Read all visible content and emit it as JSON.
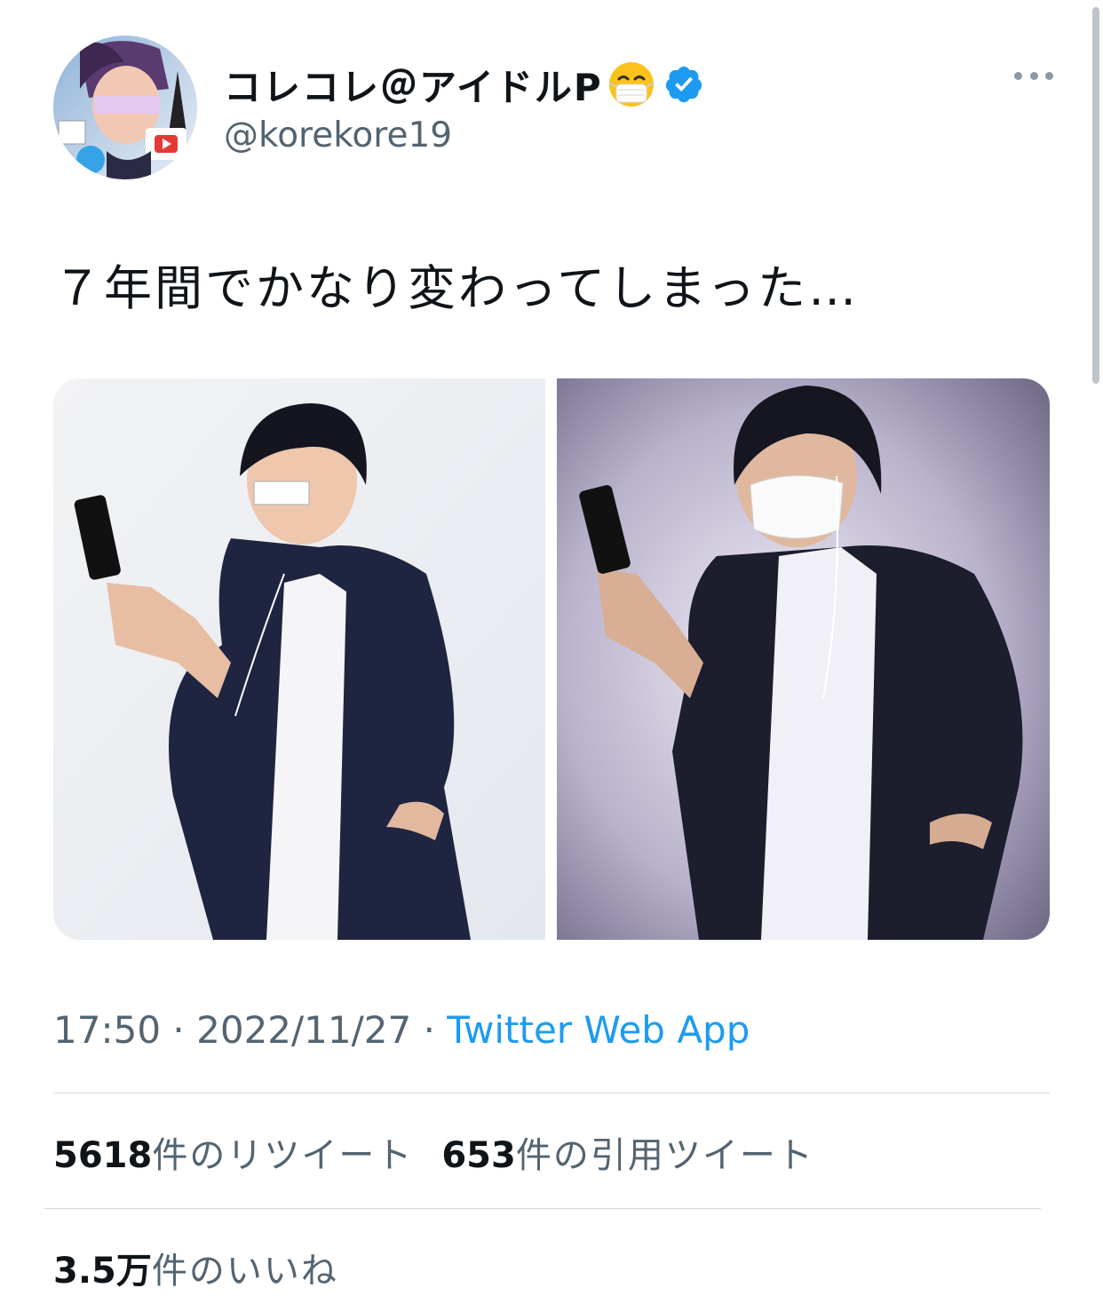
{
  "tweet": {
    "author": {
      "display_name": "コレコレ＠アイドルP",
      "handle": "@korekore19",
      "verified": true,
      "emoji": "face-with-medical-mask"
    },
    "text": "７年間でかなり変わってしまった…",
    "images": [
      {
        "description_icon": "photo-before"
      },
      {
        "description_icon": "photo-after"
      }
    ],
    "time": "17:50",
    "date": "2022/11/27",
    "separator": "·",
    "source": "Twitter Web App",
    "stats": {
      "retweets_count": "5618",
      "retweets_label": "件のリツイート",
      "quotes_count": "653",
      "quotes_label": "件の引用ツイート",
      "likes_count": "3.5万",
      "likes_label": "件のいいね"
    }
  },
  "colors": {
    "link": "#1d9bf0",
    "secondary_text": "#536471",
    "primary_text": "#0f1419",
    "verified_badge": "#1d9bf0"
  }
}
